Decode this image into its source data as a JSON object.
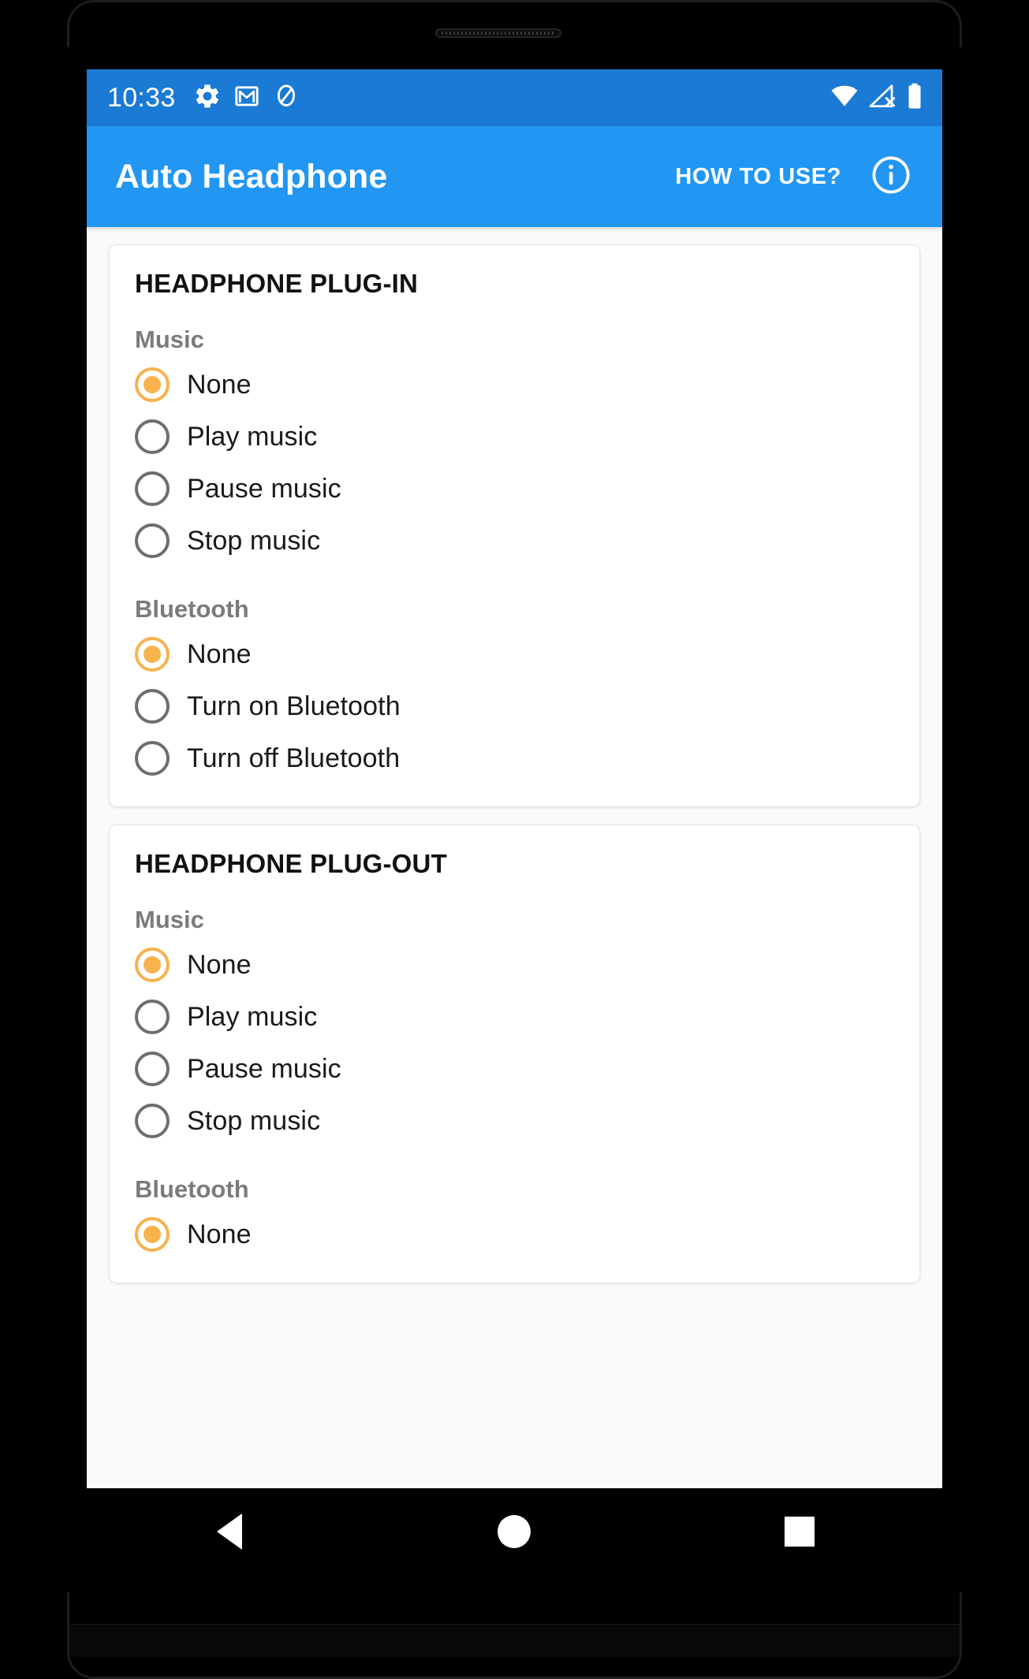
{
  "status_bar": {
    "time": "10:33",
    "left_icons": [
      "gear-icon",
      "gmail-icon",
      "do-not-disturb-icon"
    ],
    "right_icons": [
      "wifi-icon",
      "cell-signal-off-icon",
      "battery-full-icon"
    ],
    "background_color": "#1b7ad3"
  },
  "app_bar": {
    "title": "Auto Headphone",
    "action_label": "HOW TO USE?",
    "info_icon": "info-circle-icon",
    "background_color": "#2196f3"
  },
  "theme": {
    "accent_selected": "#f9b34c",
    "radio_unselected": "#6e6e6e",
    "group_label_color": "#7b7b7b",
    "page_background": "#fafafa",
    "card_background": "#ffffff"
  },
  "cards": [
    {
      "title": "HEADPHONE PLUG-IN",
      "groups": [
        {
          "label": "Music",
          "options": [
            {
              "label": "None",
              "selected": true
            },
            {
              "label": "Play music",
              "selected": false
            },
            {
              "label": "Pause music",
              "selected": false
            },
            {
              "label": "Stop music",
              "selected": false
            }
          ]
        },
        {
          "label": "Bluetooth",
          "options": [
            {
              "label": "None",
              "selected": true
            },
            {
              "label": "Turn on Bluetooth",
              "selected": false
            },
            {
              "label": "Turn off Bluetooth",
              "selected": false
            }
          ]
        }
      ]
    },
    {
      "title": "HEADPHONE PLUG-OUT",
      "groups": [
        {
          "label": "Music",
          "options": [
            {
              "label": "None",
              "selected": true
            },
            {
              "label": "Play music",
              "selected": false
            },
            {
              "label": "Pause music",
              "selected": false
            },
            {
              "label": "Stop music",
              "selected": false
            }
          ]
        },
        {
          "label": "Bluetooth",
          "options": [
            {
              "label": "None",
              "selected": true
            }
          ]
        }
      ]
    }
  ],
  "nav_bar": {
    "items": [
      {
        "name": "back-button",
        "icon": "triangle-back-icon"
      },
      {
        "name": "home-button",
        "icon": "circle-home-icon"
      },
      {
        "name": "recents-button",
        "icon": "square-recents-icon"
      }
    ]
  }
}
